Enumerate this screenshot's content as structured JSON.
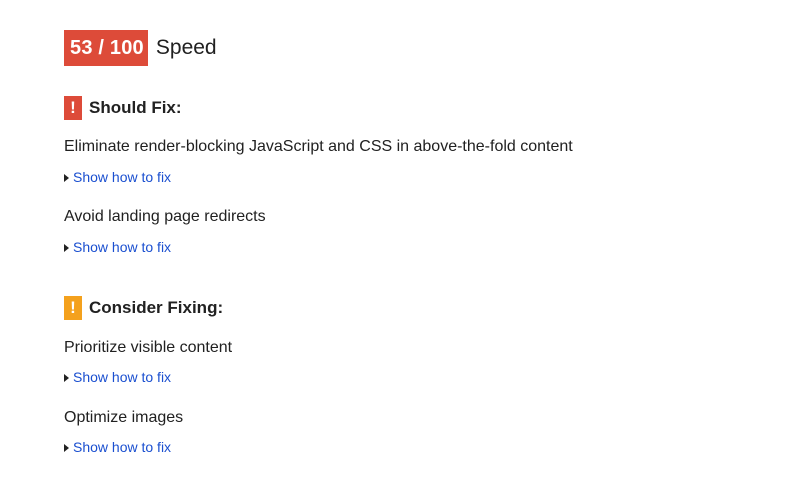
{
  "score": {
    "value": "53 / 100",
    "label": "Speed",
    "badge_color": "#dd4b39"
  },
  "sections": [
    {
      "icon": "exclamation-icon",
      "icon_glyph": "!",
      "icon_color": "#dd4b39",
      "title": "Should Fix:",
      "rules": [
        {
          "title": "Eliminate render-blocking JavaScript and CSS in above-the-fold content",
          "link": "Show how to fix"
        },
        {
          "title": "Avoid landing page redirects",
          "link": "Show how to fix"
        }
      ]
    },
    {
      "icon": "exclamation-icon",
      "icon_glyph": "!",
      "icon_color": "#f4a11d",
      "title": "Consider Fixing:",
      "rules": [
        {
          "title": "Prioritize visible content",
          "link": "Show how to fix"
        },
        {
          "title": "Optimize images",
          "link": "Show how to fix"
        }
      ]
    }
  ],
  "colors": {
    "link": "#1a4fd0",
    "text": "#212121"
  }
}
